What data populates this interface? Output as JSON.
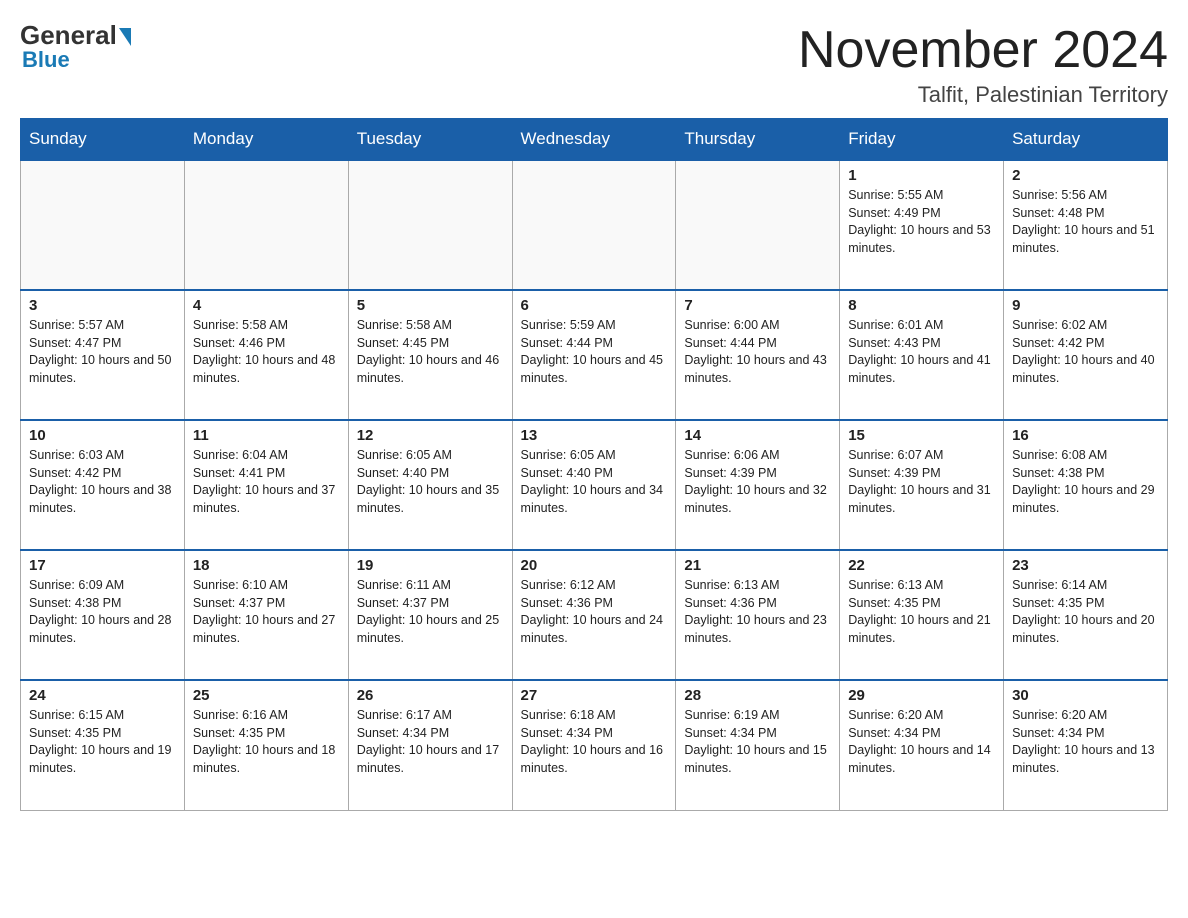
{
  "logo": {
    "general": "General",
    "blue": "Blue"
  },
  "title": "November 2024",
  "location": "Talfit, Palestinian Territory",
  "days_of_week": [
    "Sunday",
    "Monday",
    "Tuesday",
    "Wednesday",
    "Thursday",
    "Friday",
    "Saturday"
  ],
  "weeks": [
    [
      {
        "day": "",
        "info": ""
      },
      {
        "day": "",
        "info": ""
      },
      {
        "day": "",
        "info": ""
      },
      {
        "day": "",
        "info": ""
      },
      {
        "day": "",
        "info": ""
      },
      {
        "day": "1",
        "info": "Sunrise: 5:55 AM\nSunset: 4:49 PM\nDaylight: 10 hours and 53 minutes."
      },
      {
        "day": "2",
        "info": "Sunrise: 5:56 AM\nSunset: 4:48 PM\nDaylight: 10 hours and 51 minutes."
      }
    ],
    [
      {
        "day": "3",
        "info": "Sunrise: 5:57 AM\nSunset: 4:47 PM\nDaylight: 10 hours and 50 minutes."
      },
      {
        "day": "4",
        "info": "Sunrise: 5:58 AM\nSunset: 4:46 PM\nDaylight: 10 hours and 48 minutes."
      },
      {
        "day": "5",
        "info": "Sunrise: 5:58 AM\nSunset: 4:45 PM\nDaylight: 10 hours and 46 minutes."
      },
      {
        "day": "6",
        "info": "Sunrise: 5:59 AM\nSunset: 4:44 PM\nDaylight: 10 hours and 45 minutes."
      },
      {
        "day": "7",
        "info": "Sunrise: 6:00 AM\nSunset: 4:44 PM\nDaylight: 10 hours and 43 minutes."
      },
      {
        "day": "8",
        "info": "Sunrise: 6:01 AM\nSunset: 4:43 PM\nDaylight: 10 hours and 41 minutes."
      },
      {
        "day": "9",
        "info": "Sunrise: 6:02 AM\nSunset: 4:42 PM\nDaylight: 10 hours and 40 minutes."
      }
    ],
    [
      {
        "day": "10",
        "info": "Sunrise: 6:03 AM\nSunset: 4:42 PM\nDaylight: 10 hours and 38 minutes."
      },
      {
        "day": "11",
        "info": "Sunrise: 6:04 AM\nSunset: 4:41 PM\nDaylight: 10 hours and 37 minutes."
      },
      {
        "day": "12",
        "info": "Sunrise: 6:05 AM\nSunset: 4:40 PM\nDaylight: 10 hours and 35 minutes."
      },
      {
        "day": "13",
        "info": "Sunrise: 6:05 AM\nSunset: 4:40 PM\nDaylight: 10 hours and 34 minutes."
      },
      {
        "day": "14",
        "info": "Sunrise: 6:06 AM\nSunset: 4:39 PM\nDaylight: 10 hours and 32 minutes."
      },
      {
        "day": "15",
        "info": "Sunrise: 6:07 AM\nSunset: 4:39 PM\nDaylight: 10 hours and 31 minutes."
      },
      {
        "day": "16",
        "info": "Sunrise: 6:08 AM\nSunset: 4:38 PM\nDaylight: 10 hours and 29 minutes."
      }
    ],
    [
      {
        "day": "17",
        "info": "Sunrise: 6:09 AM\nSunset: 4:38 PM\nDaylight: 10 hours and 28 minutes."
      },
      {
        "day": "18",
        "info": "Sunrise: 6:10 AM\nSunset: 4:37 PM\nDaylight: 10 hours and 27 minutes."
      },
      {
        "day": "19",
        "info": "Sunrise: 6:11 AM\nSunset: 4:37 PM\nDaylight: 10 hours and 25 minutes."
      },
      {
        "day": "20",
        "info": "Sunrise: 6:12 AM\nSunset: 4:36 PM\nDaylight: 10 hours and 24 minutes."
      },
      {
        "day": "21",
        "info": "Sunrise: 6:13 AM\nSunset: 4:36 PM\nDaylight: 10 hours and 23 minutes."
      },
      {
        "day": "22",
        "info": "Sunrise: 6:13 AM\nSunset: 4:35 PM\nDaylight: 10 hours and 21 minutes."
      },
      {
        "day": "23",
        "info": "Sunrise: 6:14 AM\nSunset: 4:35 PM\nDaylight: 10 hours and 20 minutes."
      }
    ],
    [
      {
        "day": "24",
        "info": "Sunrise: 6:15 AM\nSunset: 4:35 PM\nDaylight: 10 hours and 19 minutes."
      },
      {
        "day": "25",
        "info": "Sunrise: 6:16 AM\nSunset: 4:35 PM\nDaylight: 10 hours and 18 minutes."
      },
      {
        "day": "26",
        "info": "Sunrise: 6:17 AM\nSunset: 4:34 PM\nDaylight: 10 hours and 17 minutes."
      },
      {
        "day": "27",
        "info": "Sunrise: 6:18 AM\nSunset: 4:34 PM\nDaylight: 10 hours and 16 minutes."
      },
      {
        "day": "28",
        "info": "Sunrise: 6:19 AM\nSunset: 4:34 PM\nDaylight: 10 hours and 15 minutes."
      },
      {
        "day": "29",
        "info": "Sunrise: 6:20 AM\nSunset: 4:34 PM\nDaylight: 10 hours and 14 minutes."
      },
      {
        "day": "30",
        "info": "Sunrise: 6:20 AM\nSunset: 4:34 PM\nDaylight: 10 hours and 13 minutes."
      }
    ]
  ]
}
